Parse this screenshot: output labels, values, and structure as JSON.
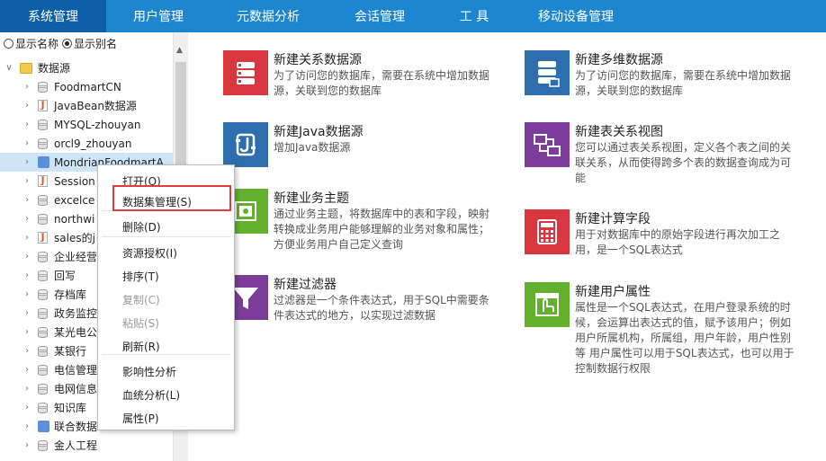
{
  "nav": {
    "tabs": [
      "系统管理",
      "用户管理",
      "元数据分析",
      "会话管理",
      "工 具",
      "移动设备管理"
    ]
  },
  "left": {
    "radio_show_name": "显示名称",
    "radio_show_alias": "显示别名",
    "tree": [
      {
        "label": "数据源",
        "icon": "folder-icon",
        "level": 0
      },
      {
        "label": "FoodmartCN",
        "icon": "database-icon",
        "level": 1
      },
      {
        "label": "JavaBean数据源",
        "icon": "java-icon",
        "level": 1
      },
      {
        "label": "MYSQL-zhouyan",
        "icon": "database-icon",
        "level": 1
      },
      {
        "label": "orcl9_zhouyan",
        "icon": "database-icon",
        "level": 1
      },
      {
        "label": "MondrianFoodmartA",
        "icon": "multidim-icon",
        "level": 1
      },
      {
        "label": "Session",
        "icon": "java-icon",
        "level": 1
      },
      {
        "label": "excelce",
        "icon": "database-icon",
        "level": 1
      },
      {
        "label": "northwi",
        "icon": "database-icon",
        "level": 1
      },
      {
        "label": "sales的j",
        "icon": "java-icon",
        "level": 1
      },
      {
        "label": "企业经营",
        "icon": "database-icon",
        "level": 1
      },
      {
        "label": "回写",
        "icon": "database-icon",
        "level": 1
      },
      {
        "label": "存档库",
        "icon": "database-icon",
        "level": 1
      },
      {
        "label": "政务监控",
        "icon": "database-icon",
        "level": 1
      },
      {
        "label": "某光电公",
        "icon": "database-icon",
        "level": 1
      },
      {
        "label": "某银行",
        "icon": "database-icon",
        "level": 1
      },
      {
        "label": "电信管理",
        "icon": "database-icon",
        "level": 1
      },
      {
        "label": "电网信息",
        "icon": "database-icon",
        "level": 1
      },
      {
        "label": "知识库",
        "icon": "database-icon",
        "level": 1
      },
      {
        "label": "联合数据",
        "icon": "multidim-icon",
        "level": 1
      },
      {
        "label": "金人工程",
        "icon": "database-icon",
        "level": 1
      }
    ]
  },
  "items": [
    {
      "title": "新建关系数据源",
      "desc": "为了访问您的数据库，需要在系统中增加数据源，关联到您的数据库",
      "icon": "relational-db-icon",
      "color": "#d9373f"
    },
    {
      "title": "新建多维数据源",
      "desc": "为了访问您的数据库，需要在系统中增加数据源，关联到您的数据库",
      "icon": "multidim-db-icon",
      "color": "#2d6fae"
    },
    {
      "title": "新建Java数据源",
      "desc": "增加Java数据源",
      "icon": "java-source-icon",
      "color": "#2d6fae"
    },
    {
      "title": "新建表关系视图",
      "desc": "您可以通过表关系视图，定义各个表之间的关联关系，从而使得跨多个表的数据查询成为可能",
      "icon": "table-relation-icon",
      "color": "#7c3d9a"
    },
    {
      "title": "新建业务主题",
      "desc": "通过业务主题，将数据库中的表和字段，映射转换成业务用户能够理解的业务对象和属性；方便业务用户自己定义查询",
      "icon": "business-topic-icon",
      "color": "#62b02e"
    },
    {
      "title": "新建计算字段",
      "desc": "用于对数据库中的原始字段进行再次加工之用，是一个SQL表达式",
      "icon": "calculator-icon",
      "color": "#d9373f"
    },
    {
      "title": "新建过滤器",
      "desc": "过滤器是一个条件表达式，用于SQL中需要条件表达式的地方，以实现过滤数据",
      "icon": "filter-icon",
      "color": "#7c3d9a"
    },
    {
      "title": "新建用户属性",
      "desc": "属性是一个SQL表达式，在用户登录系统的时候，会运算出表达式的值，赋予该用户；例如用户所属机构，所属组，用户年龄，用户性别等 用户属性可以用于SQL表达式，也可以用于控制数据行权限",
      "icon": "user-attribute-icon",
      "color": "#62b02e"
    }
  ],
  "context_menu": [
    {
      "label": "打开(O)",
      "enabled": true
    },
    {
      "label": "数据集管理(S)",
      "enabled": true
    },
    {
      "label": "删除(D)",
      "enabled": true
    },
    {
      "label": "资源授权(I)",
      "enabled": true
    },
    {
      "label": "排序(T)",
      "enabled": true
    },
    {
      "label": "复制(C)",
      "enabled": false
    },
    {
      "label": "粘贴(S)",
      "enabled": false
    },
    {
      "label": "刷新(R)",
      "enabled": true
    },
    {
      "label": "影响性分析",
      "enabled": true
    },
    {
      "label": "血统分析(L)",
      "enabled": true
    },
    {
      "label": "属性(P)",
      "enabled": true
    }
  ]
}
